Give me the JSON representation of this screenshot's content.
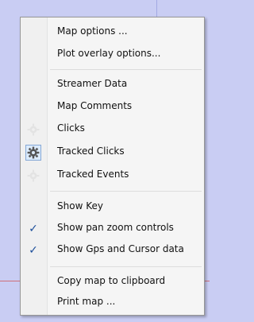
{
  "menu": {
    "group1": [
      {
        "label": "Map options ...",
        "icon": null
      },
      {
        "label": "Plot overlay options...",
        "icon": null
      }
    ],
    "group2": [
      {
        "label": "Streamer Data",
        "icon": null
      },
      {
        "label": "Map Comments",
        "icon": null
      },
      {
        "label": "Clicks",
        "icon": "gear-icon-faded"
      },
      {
        "label": "Tracked Clicks",
        "icon": "gear-icon-selected"
      },
      {
        "label": "Tracked Events",
        "icon": "gear-icon-faded"
      }
    ],
    "group3": [
      {
        "label": "Show Key",
        "checked": false
      },
      {
        "label": "Show pan zoom controls",
        "checked": true
      },
      {
        "label": "Show Gps and Cursor data",
        "checked": true
      }
    ],
    "group4": [
      {
        "label": "Copy map to clipboard",
        "icon": null
      },
      {
        "label": "Print map ...",
        "icon": null
      }
    ]
  },
  "colors": {
    "menu_bg": "#f5f5f5",
    "check": "#1d4f9b",
    "selected_icon_bg": "#dcebfb"
  }
}
